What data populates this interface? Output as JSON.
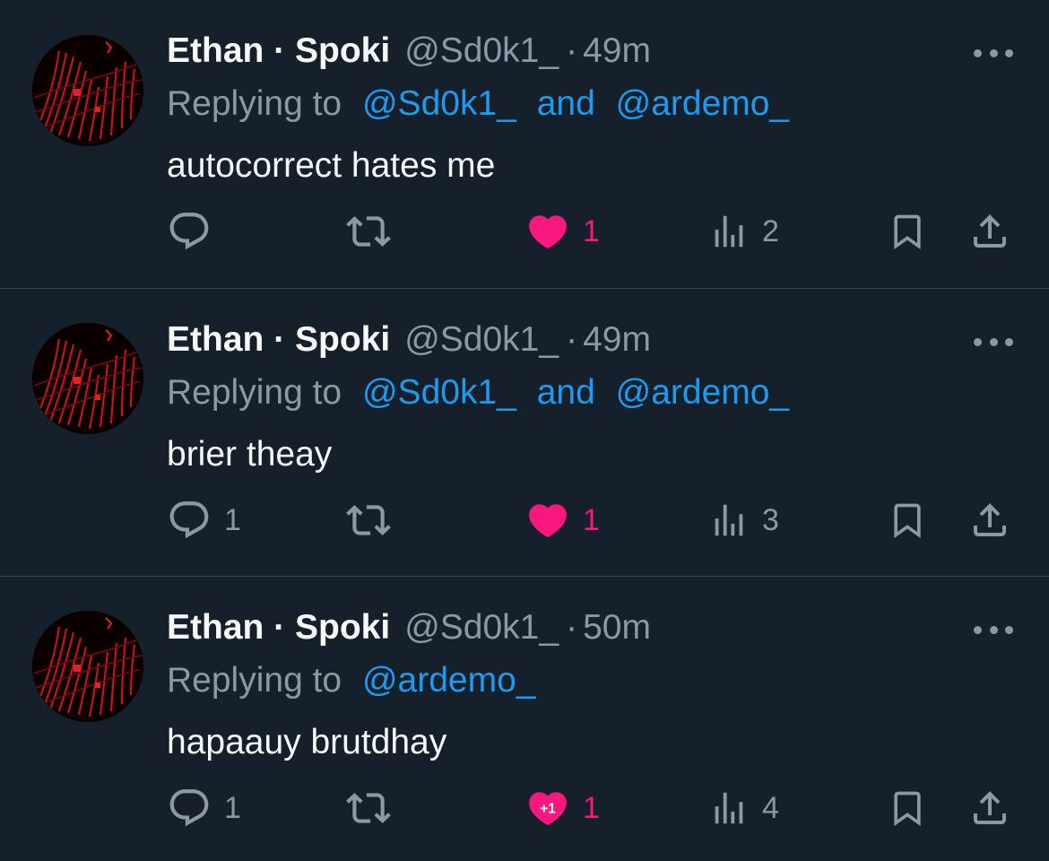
{
  "colors": {
    "background": "#15202b",
    "divider": "#38444d",
    "text_primary": "#f7f9f9",
    "text_secondary": "#8b98a5",
    "mention": "#1d9bf0",
    "like": "#f91880"
  },
  "tweets": [
    {
      "name": "Ethan · Spoki",
      "handle": "@Sd0k1_",
      "dot": "·",
      "time": "49m",
      "replying_prefix": "Replying to",
      "mentions": [
        "@Sd0k1_",
        "@ardemo_"
      ],
      "mention_joiner": "and",
      "text": "autocorrect hates me",
      "reply_count": "",
      "retweet_count": "",
      "like_count": "1",
      "like_badge": "",
      "view_count": "2",
      "icons": [
        "avatar",
        "more-icon",
        "reply-icon",
        "retweet-icon",
        "heart-icon",
        "views-icon",
        "bookmark-icon",
        "share-icon"
      ]
    },
    {
      "name": "Ethan · Spoki",
      "handle": "@Sd0k1_",
      "dot": "·",
      "time": "49m",
      "replying_prefix": "Replying to",
      "mentions": [
        "@Sd0k1_",
        "@ardemo_"
      ],
      "mention_joiner": "and",
      "text": "brier theay",
      "reply_count": "1",
      "retweet_count": "",
      "like_count": "1",
      "like_badge": "",
      "view_count": "3",
      "icons": [
        "avatar",
        "more-icon",
        "reply-icon",
        "retweet-icon",
        "heart-icon",
        "views-icon",
        "bookmark-icon",
        "share-icon"
      ]
    },
    {
      "name": "Ethan · Spoki",
      "handle": "@Sd0k1_",
      "dot": "·",
      "time": "50m",
      "replying_prefix": "Replying to",
      "mentions": [
        "@ardemo_"
      ],
      "mention_joiner": "",
      "text": "hapaauy brutdhay",
      "reply_count": "1",
      "retweet_count": "",
      "like_count": "1",
      "like_badge": "+1",
      "view_count": "4",
      "icons": [
        "avatar",
        "more-icon",
        "reply-icon",
        "retweet-icon",
        "heart-icon",
        "views-icon",
        "bookmark-icon",
        "share-icon"
      ]
    }
  ]
}
